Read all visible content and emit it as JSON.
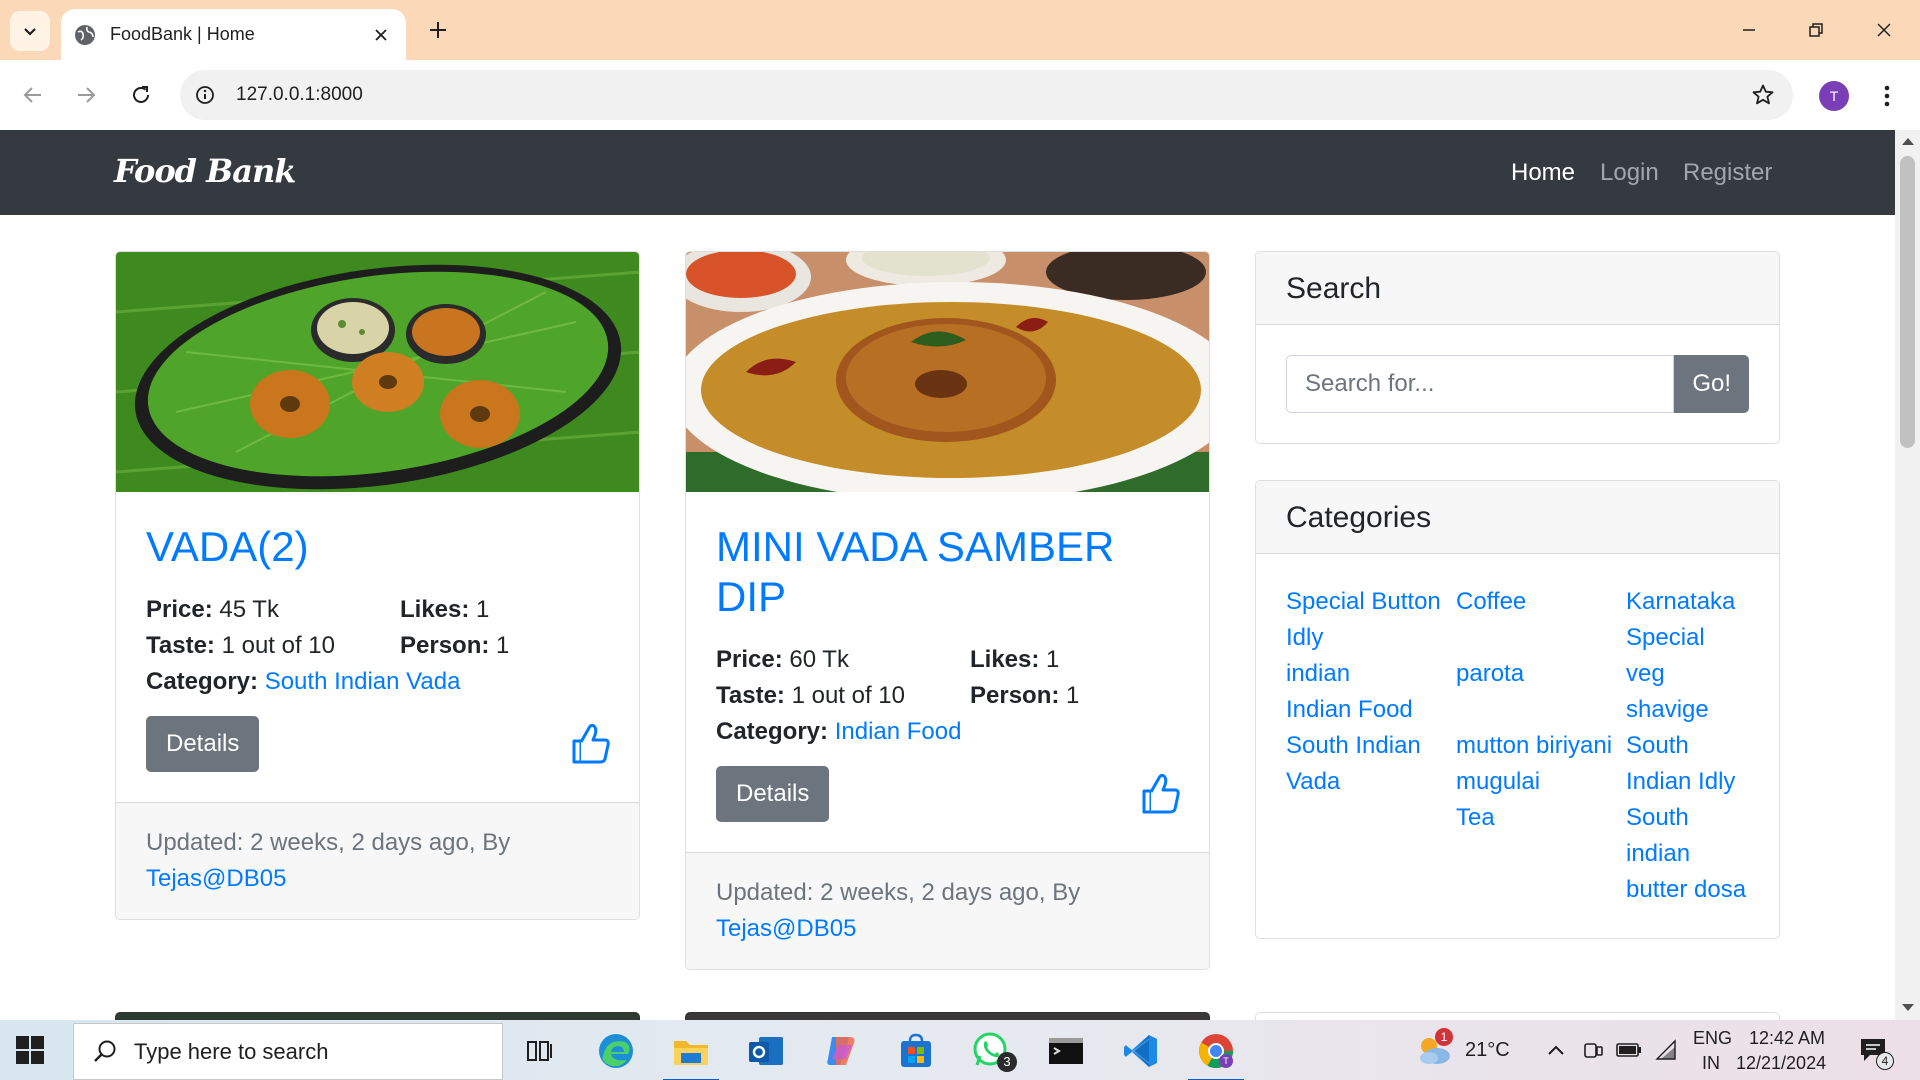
{
  "browser": {
    "tab_title": "FoodBank | Home",
    "url": "127.0.0.1:8000",
    "profile_initial": "T"
  },
  "site": {
    "brand": "Food Bank",
    "nav": [
      {
        "label": "Home",
        "active": true
      },
      {
        "label": "Login",
        "active": false
      },
      {
        "label": "Register",
        "active": false
      }
    ]
  },
  "posts": [
    {
      "title": "VADA(2)",
      "price_label": "Price:",
      "price": "45 Tk",
      "likes_label": "Likes:",
      "likes": "1",
      "taste_label": "Taste:",
      "taste": "1 out of 10",
      "person_label": "Person:",
      "person": "1",
      "category_label": "Category:",
      "category": "South Indian Vada",
      "details_label": "Details",
      "updated": "Updated: 2 weeks, 2 days ago, By",
      "author": "Tejas@DB05"
    },
    {
      "title": "MINI VADA SAMBER DIP",
      "price_label": "Price:",
      "price": "60 Tk",
      "likes_label": "Likes:",
      "likes": "1",
      "taste_label": "Taste:",
      "taste": "1 out of 10",
      "person_label": "Person:",
      "person": "1",
      "category_label": "Category:",
      "category": "Indian Food",
      "details_label": "Details",
      "updated": "Updated: 2 weeks, 2 days ago, By",
      "author": "Tejas@DB05"
    }
  ],
  "sidebar": {
    "search_title": "Search",
    "search_placeholder": "Search for...",
    "go_label": "Go!",
    "categories_title": "Categories",
    "categories": [
      [
        "Special Button Idly",
        "indian",
        "Indian Food",
        "South Indian Vada"
      ],
      [
        "Coffee",
        "parota",
        "mutton biriyani",
        "mugulai",
        "Tea"
      ],
      [
        "Karnataka Special",
        "veg shavige",
        "South Indian Idly",
        "South indian butter dosa"
      ]
    ]
  },
  "taskbar": {
    "search_placeholder": "Type here to search",
    "temperature": "21°C",
    "weather_badge": "1",
    "whatsapp_badge": "3",
    "lang_top": "ENG",
    "lang_bottom": "IN",
    "time": "12:42 AM",
    "date": "12/21/2024",
    "notification_count": "4"
  },
  "colors": {
    "brand_blue": "#007bff",
    "nav_dark": "#343a40",
    "button_gray": "#6c757d",
    "tabbar_peach": "#fbd8b7"
  }
}
